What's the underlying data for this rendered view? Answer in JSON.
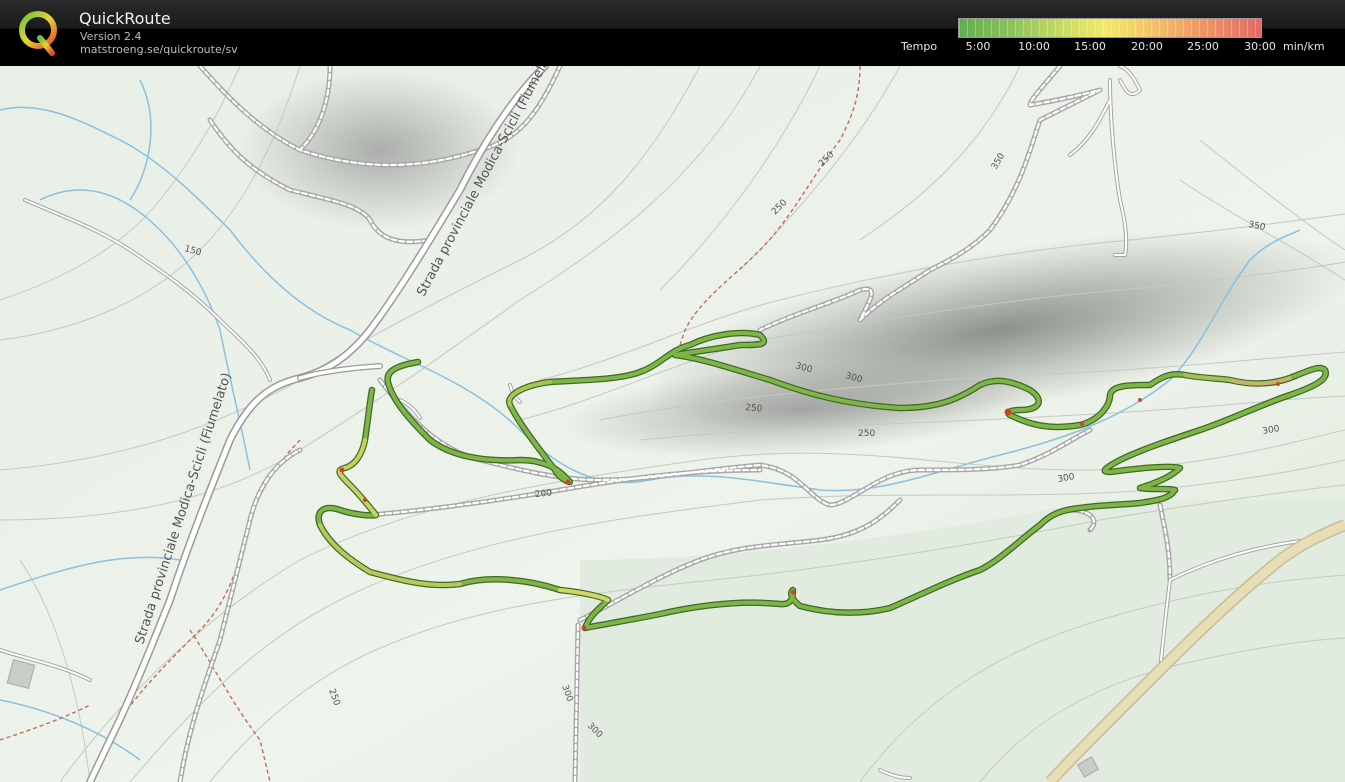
{
  "app": {
    "title": "QuickRoute",
    "version": "Version 2.4",
    "url": "matstroeng.se/quickroute/sv"
  },
  "legend": {
    "label": "Tempo",
    "ticks": [
      "5:00",
      "10:00",
      "15:00",
      "20:00",
      "25:00",
      "30:00"
    ],
    "unit": "min/km",
    "colors": {
      "fast": "#5fae52",
      "medium": "#f0ea6e",
      "slow": "#e56a66"
    }
  },
  "map": {
    "road_labels": [
      "Strada provinciale Modica-Scicli (Fiumelato)",
      "Strada provinciale Modica-Scicli (Fiumelato)"
    ],
    "contour_labels": [
      "150",
      "200",
      "250",
      "250",
      "250",
      "250",
      "250",
      "300",
      "300",
      "300",
      "300",
      "300",
      "300",
      "350",
      "350"
    ],
    "colors": {
      "route": "#7fb449",
      "route_outline": "#3e6a25",
      "road": "#ffffff",
      "road_casing": "#a7a7a7",
      "path_red": "#c46a5e",
      "water": "#8cc0de",
      "contour": "#c3cac1",
      "highway": "#e8ddb6"
    }
  }
}
